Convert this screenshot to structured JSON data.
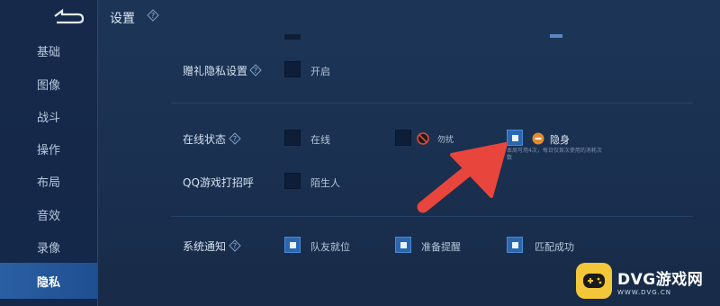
{
  "header": {
    "title": "设置",
    "help_icon": "help-diamond-icon",
    "back_icon": "back-arrow-icon"
  },
  "sidebar": {
    "items": [
      {
        "label": "基础",
        "active": false
      },
      {
        "label": "图像",
        "active": false
      },
      {
        "label": "战斗",
        "active": false
      },
      {
        "label": "操作",
        "active": false
      },
      {
        "label": "布局",
        "active": false
      },
      {
        "label": "音效",
        "active": false
      },
      {
        "label": "录像",
        "active": false
      },
      {
        "label": "隐私",
        "active": true
      }
    ]
  },
  "gift_privacy": {
    "label": "赠礼隐私设置",
    "option": "开启",
    "checked": false
  },
  "online_status": {
    "label": "在线状态",
    "options": [
      {
        "label": "在线",
        "checked": false
      },
      {
        "label": "勿扰",
        "checked": false,
        "icon": "no-disturb-icon"
      },
      {
        "label": "隐身",
        "checked": true,
        "icon": "invisible-icon"
      }
    ],
    "note": "本周可用4次，每日仅首次使用的消耗次数"
  },
  "qq_greeting": {
    "label": "QQ游戏打招呼",
    "option": "陌生人",
    "checked": false
  },
  "system_notice": {
    "label": "系统通知",
    "options": [
      {
        "label": "队友就位",
        "checked": true
      },
      {
        "label": "准备提醒",
        "checked": true
      },
      {
        "label": "匹配成功",
        "checked": true
      }
    ]
  },
  "watermark": {
    "main": "DVG游戏网",
    "sub": "WWW.DVG.CN"
  },
  "colors": {
    "accent": "#2a67b0",
    "arrow": "#e8453c",
    "active_tab": "#2a5fa3"
  }
}
